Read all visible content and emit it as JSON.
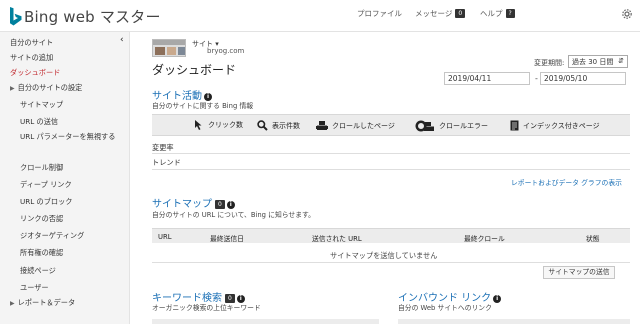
{
  "header": {
    "brand": "Bing",
    "product": "web マスター",
    "nav": {
      "profile": "プロファイル",
      "messages": "メッセージ",
      "messages_count": "0",
      "help": "ヘルプ",
      "help_count": "?"
    }
  },
  "sidebar": {
    "items": [
      {
        "label": "自分のサイト"
      },
      {
        "label": "サイトの追加"
      },
      {
        "label": "ダッシュボード"
      },
      {
        "label": "自分のサイトの設定"
      },
      {
        "label": "サイトマップ"
      },
      {
        "label": "URL の送信"
      },
      {
        "label": "URL パラメーターを無視する"
      },
      {
        "label": "クロール制御"
      },
      {
        "label": "ディープ リンク"
      },
      {
        "label": "URL のブロック"
      },
      {
        "label": "リンクの否認"
      },
      {
        "label": "ジオターゲティング"
      },
      {
        "label": "所有権の確認"
      },
      {
        "label": "接続ページ"
      },
      {
        "label": "ユーザー"
      },
      {
        "label": "レポート＆データ"
      }
    ]
  },
  "site": {
    "label": "サイト",
    "url": "bryog.com"
  },
  "dashboard": {
    "title": "ダッシュボード",
    "period_label": "変更期間:",
    "period_value": "過去 30 日間",
    "date_from": "2019/04/11",
    "date_to": "2019/05/10",
    "date_separator": "-"
  },
  "site_activity": {
    "title": "サイト活動",
    "description": "自分のサイトに関する Bing 情報",
    "metrics": [
      {
        "label": "クリック数",
        "icon": "cursor-icon"
      },
      {
        "label": "表示件数",
        "icon": "magnifier-icon"
      },
      {
        "label": "クロールしたページ",
        "icon": "robot-icon"
      },
      {
        "label": "クロールエラー",
        "icon": "error-robot-icon"
      },
      {
        "label": "インデックス付きページ",
        "icon": "document-icon"
      }
    ],
    "change_rate_label": "変更率",
    "trend_label": "トレンド",
    "reports_link": "レポートおよびデータ グラフの表示"
  },
  "sitemaps": {
    "title": "サイトマップ",
    "badge": "0",
    "description": "自分のサイトの URL について、Bing に知らせます。",
    "columns": [
      "URL",
      "最終送信日",
      "送信された URL",
      "最終クロール",
      "状態"
    ],
    "empty_message": "サイトマップを送信していません",
    "submit_button": "サイトマップの送信"
  },
  "keywords": {
    "title": "キーワード検索",
    "badge": "0",
    "description": "オーガニック検索の上位キーワード"
  },
  "inbound_links": {
    "title": "インバウンド リンク",
    "description": "自分の Web サイトへのリンク"
  },
  "colors": {
    "accent": "#1a6fb5",
    "active": "#c1272d",
    "brand": "#00809d"
  }
}
